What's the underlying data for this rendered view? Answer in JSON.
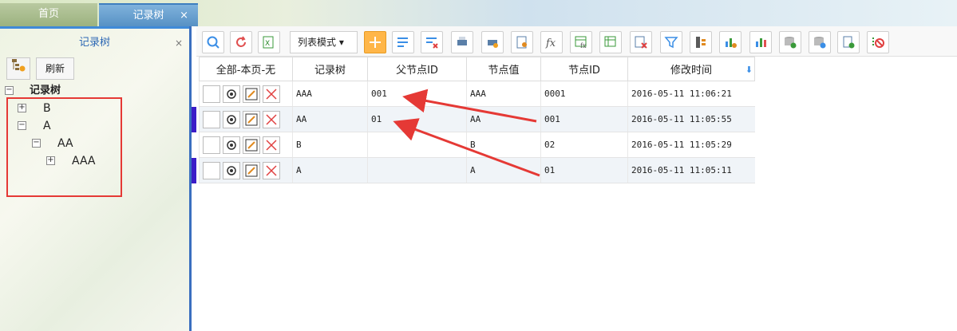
{
  "tabs": {
    "home": "首页",
    "active": "记录树",
    "close": "×"
  },
  "left_panel": {
    "title": "记录树",
    "close": "×",
    "refresh_label": "刷新",
    "tree": {
      "root": "记录树",
      "b": "B",
      "a": "A",
      "aa": "AA",
      "aaa": "AAA"
    }
  },
  "toolbar": {
    "mode_label": "列表模式",
    "buttons": [
      "search-icon",
      "refresh-icon",
      "excel-icon",
      "add-icon",
      "edit-list-icon",
      "delete-list-icon",
      "print-icon",
      "print-preview-icon",
      "settings-icon",
      "formula-icon",
      "table-formula-icon",
      "table-edit-icon",
      "clear-icon",
      "filter-icon",
      "sort-icon",
      "chart-settings-icon",
      "chart-icon",
      "database-export-icon",
      "database-import-icon",
      "export-icon",
      "disable-icon"
    ]
  },
  "grid": {
    "columns": {
      "select": "全部-本页-无",
      "tree": "记录树",
      "parent_id": "父节点ID",
      "node_value": "节点值",
      "node_id": "节点ID",
      "modified": "修改时间"
    },
    "rows": [
      {
        "tree": "AAA",
        "parent_id": "001",
        "node_value": "AAA",
        "node_id": "0001",
        "modified": "2016-05-11 11:06:21"
      },
      {
        "tree": "AA",
        "parent_id": "01",
        "node_value": "AA",
        "node_id": "001",
        "modified": "2016-05-11 11:05:55"
      },
      {
        "tree": "B",
        "parent_id": "",
        "node_value": "B",
        "node_id": "02",
        "modified": "2016-05-11 11:05:29"
      },
      {
        "tree": "A",
        "parent_id": "",
        "node_value": "A",
        "node_id": "01",
        "modified": "2016-05-11 11:05:11"
      }
    ]
  },
  "colors": {
    "accent": "#3a8ee6",
    "annotation": "#e53935",
    "row_marker": "#3b1cc7"
  }
}
